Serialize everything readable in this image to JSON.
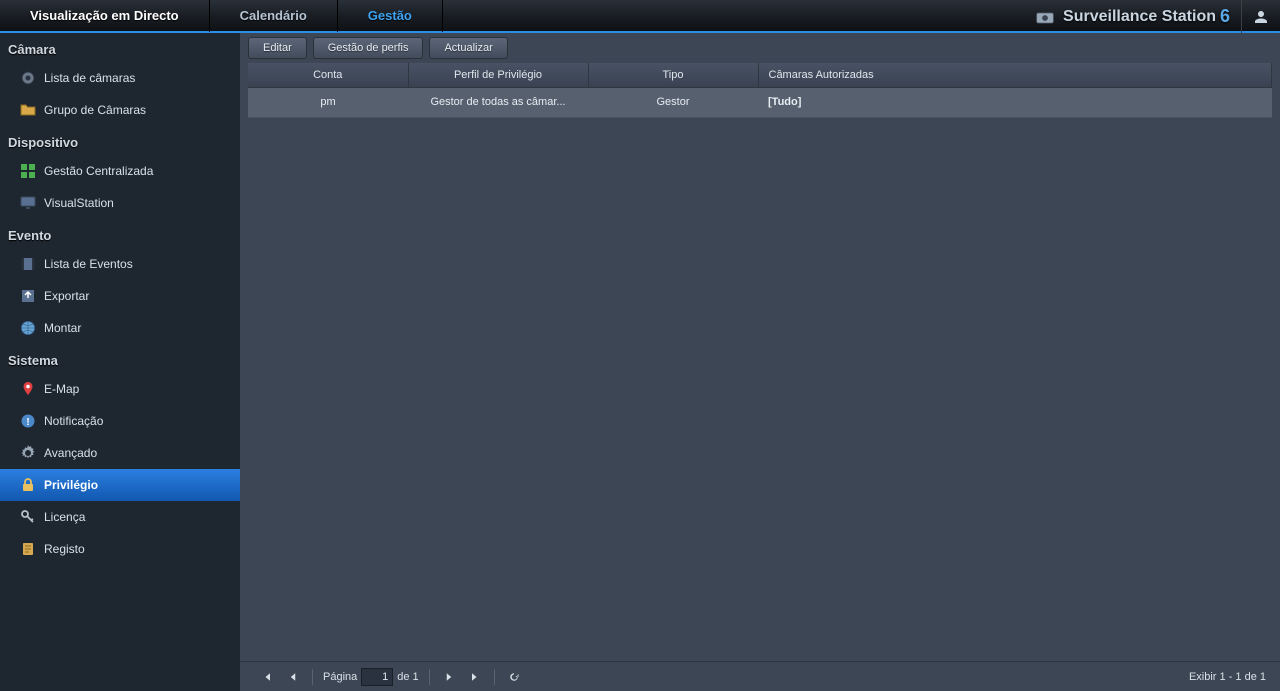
{
  "topnav": {
    "tabs": [
      {
        "id": "live",
        "label": "Visualização em Directo",
        "active": false
      },
      {
        "id": "calendar",
        "label": "Calendário",
        "active": false
      },
      {
        "id": "management",
        "label": "Gestão",
        "active": true
      }
    ],
    "brand": "Surveillance Station",
    "brand_version": "6"
  },
  "sidebar": {
    "sections": [
      {
        "title": "Câmara",
        "items": [
          {
            "id": "camera-list",
            "icon": "camera-icon",
            "label": "Lista de câmaras"
          },
          {
            "id": "camera-group",
            "icon": "folder-icon",
            "label": "Grupo de Câmaras"
          }
        ]
      },
      {
        "title": "Dispositivo",
        "items": [
          {
            "id": "central",
            "icon": "grid-icon",
            "label": "Gestão Centralizada"
          },
          {
            "id": "visualstation",
            "icon": "monitor-icon",
            "label": "VisualStation"
          }
        ]
      },
      {
        "title": "Evento",
        "items": [
          {
            "id": "event-list",
            "icon": "film-icon",
            "label": "Lista de Eventos"
          },
          {
            "id": "export",
            "icon": "export-icon",
            "label": "Exportar"
          },
          {
            "id": "mount",
            "icon": "globe-icon",
            "label": "Montar"
          }
        ]
      },
      {
        "title": "Sistema",
        "items": [
          {
            "id": "emap",
            "icon": "pin-icon",
            "label": "E-Map"
          },
          {
            "id": "notification",
            "icon": "alert-icon",
            "label": "Notificação"
          },
          {
            "id": "advanced",
            "icon": "gear-icon",
            "label": "Avançado"
          },
          {
            "id": "privilege",
            "icon": "lock-icon",
            "label": "Privilégio",
            "active": true
          },
          {
            "id": "license",
            "icon": "key-icon",
            "label": "Licença"
          },
          {
            "id": "log",
            "icon": "log-icon",
            "label": "Registo"
          }
        ]
      }
    ]
  },
  "toolbar": {
    "edit": "Editar",
    "profiles": "Gestão de perfis",
    "refresh": "Actualizar"
  },
  "table": {
    "columns": [
      "Conta",
      "Perfil de Privilégio",
      "Tipo",
      "Câmaras Autorizadas"
    ],
    "rows": [
      {
        "account": "pm",
        "profile": "Gestor de todas as câmar...",
        "type": "Gestor",
        "cameras": "[Tudo]"
      }
    ]
  },
  "pager": {
    "page_label": "Página",
    "page_value": "1",
    "of_label": "de 1",
    "display": "Exibir 1 - 1 de 1"
  }
}
